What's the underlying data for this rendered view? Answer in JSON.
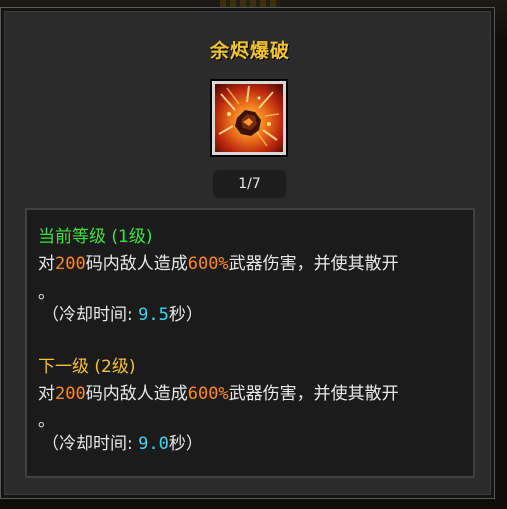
{
  "skill": {
    "name": "余烬爆破",
    "level_counter": "1/7",
    "icon": "ember-blast-icon"
  },
  "current_level": {
    "header": "当前等级 (1级)",
    "desc_prefix": "对",
    "range_value": "200",
    "desc_mid": "码内敌人造成",
    "damage_value": "600%",
    "desc_suffix": "武器伤害，并使其散开",
    "desc_end": "。",
    "cooldown_label": "（冷却时间:",
    "cooldown_value": "9.5",
    "cooldown_unit": "秒）"
  },
  "next_level": {
    "header": "下一级 (2级)",
    "desc_prefix": "对",
    "range_value": "200",
    "desc_mid": "码内敌人造成",
    "damage_value": "600%",
    "desc_suffix": "武器伤害，并使其散开",
    "desc_end": "。",
    "cooldown_label": "（冷却时间:",
    "cooldown_value": "9.0",
    "cooldown_unit": "秒）"
  },
  "colors": {
    "title": "#f2c230",
    "current_header": "#3ee23e",
    "next_header": "#f2c230",
    "highlight_value": "#ff8a1a",
    "cooldown_value": "#37d7f0"
  }
}
